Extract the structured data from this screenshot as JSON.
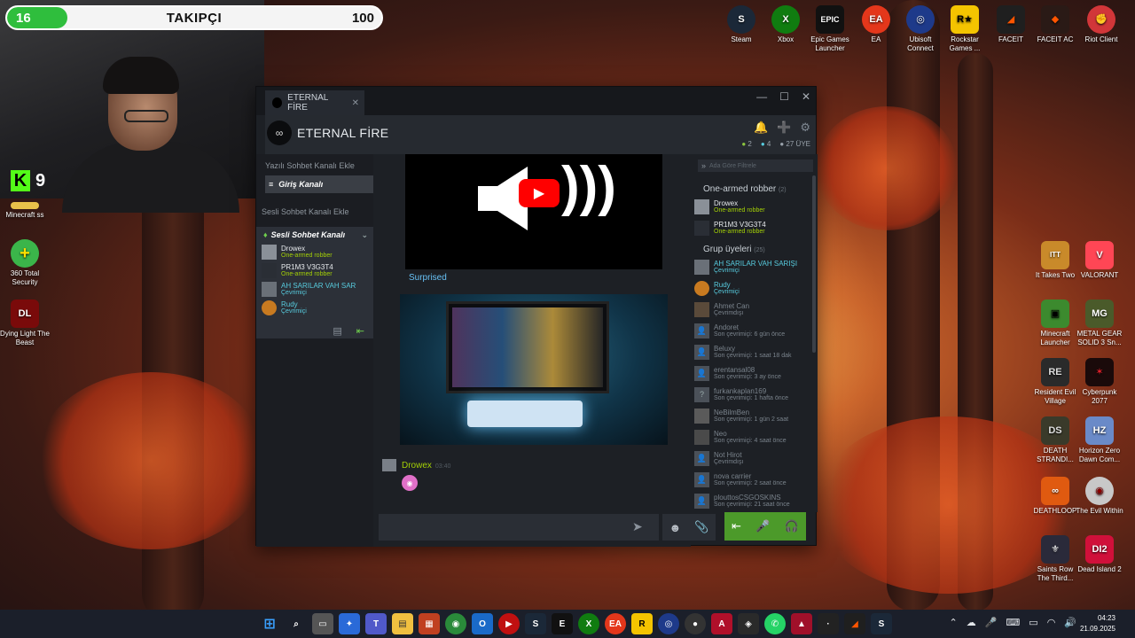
{
  "stream_overlay": {
    "follower_current": "16",
    "follower_label": "TAKIPÇI",
    "follower_goal": "100",
    "follower_progress": 0.16,
    "kick_count": "9"
  },
  "desktop_icons_top": [
    {
      "label": "Steam",
      "icon": "steam-icon",
      "color": "#1b2838"
    },
    {
      "label": "Xbox",
      "icon": "xbox-icon",
      "color": "#107c10"
    },
    {
      "label": "Epic Games Launcher",
      "icon": "epic-icon",
      "color": "#111111"
    },
    {
      "label": "EA",
      "icon": "ea-icon",
      "color": "#e4371b"
    },
    {
      "label": "Ubisoft Connect",
      "icon": "ubisoft-icon",
      "color": "#1e3a8a"
    },
    {
      "label": "Rockstar Games ...",
      "icon": "rockstar-icon",
      "color": "#f4c400"
    },
    {
      "label": "FACEIT",
      "icon": "faceit-icon",
      "color": "#1f1f1f"
    },
    {
      "label": "FACEIT AC",
      "icon": "faceit-ac-icon",
      "color": "#2a1a16"
    },
    {
      "label": "Riot Client",
      "icon": "riot-icon",
      "color": "#d13639"
    }
  ],
  "desktop_icons_left": [
    {
      "label": "Minecraft ss"
    },
    {
      "label": "360 Total Security"
    },
    {
      "label": "Dying Light The Beast"
    }
  ],
  "desktop_icons_right": [
    {
      "label": "It Takes Two"
    },
    {
      "label": "VALORANT"
    },
    {
      "label": "Minecraft Launcher"
    },
    {
      "label": "METAL GEAR SOLID 3 Sn..."
    },
    {
      "label": "Resident Evil Village"
    },
    {
      "label": "Cyberpunk 2077"
    },
    {
      "label": "DEATH STRANDI..."
    },
    {
      "label": "Horizon Zero Dawn Com..."
    },
    {
      "label": "DEATHLOOP"
    },
    {
      "label": "The Evil Within"
    },
    {
      "label": "Saints Row The Third..."
    },
    {
      "label": "Dead Island 2"
    }
  ],
  "steam_chat": {
    "tab_title": "ETERNAL FİRE",
    "group_name": "ETERNAL FİRE",
    "stats": {
      "in_game": "2",
      "online": "4",
      "members": "27 ÜYE"
    },
    "add_text_channel": "Yazılı Sohbet Kanalı Ekle",
    "text_channel": "Giriş Kanalı",
    "add_voice_channel": "Sesli Sohbet Kanalı Ekle",
    "voice_channel": "Sesli Sohbet Kanalı",
    "voice_users": [
      {
        "name": "Drowex",
        "status": "One-armed robber",
        "tone": "green"
      },
      {
        "name": "PR1M3 V3G3T4",
        "status": "One-armed robber",
        "tone": "green"
      },
      {
        "name": "AH SARILAR VAH SAR",
        "status": "Çevrimiçi",
        "tone": "blue"
      },
      {
        "name": "Rudy",
        "status": "Çevrimiçi",
        "tone": "blue"
      }
    ],
    "video_caption": "Surprised",
    "message": {
      "author": "Drowex",
      "time": "03:40"
    },
    "member_filter_placeholder": "Ada Göre Filtrele",
    "sections": {
      "playing_title": "One-armed robber",
      "playing_count": "(2)",
      "members_title": "Grup üyeleri",
      "members_count": "(25)"
    },
    "playing_members": [
      {
        "name": "Drowex",
        "status": "One-armed robber"
      },
      {
        "name": "PR1M3 V3G3T4",
        "status": "One-armed robber"
      }
    ],
    "group_members": [
      {
        "name": "AH SARILAR VAH SARIŞI",
        "status": "Çevrimiçi",
        "tone": "blue"
      },
      {
        "name": "Rudy",
        "status": "Çevrimiçi",
        "tone": "blue"
      },
      {
        "name": "Ahmet Can",
        "status": "Çevrimdışı",
        "tone": "gray"
      },
      {
        "name": "Andoret",
        "status": "Son çevrimiçi: 6 gün önce",
        "tone": "gray"
      },
      {
        "name": "Beluxy",
        "status": "Son çevrimiçi: 1 saat 18 dak",
        "tone": "gray"
      },
      {
        "name": "erentansal08",
        "status": "Son çevrimiçi: 3 ay önce",
        "tone": "gray"
      },
      {
        "name": "furkankaplan169",
        "status": "Son çevrimiçi: 1 hafta önce",
        "tone": "gray"
      },
      {
        "name": "NeBilmBen",
        "status": "Son çevrimiçi: 1 gün 2 saat",
        "tone": "gray"
      },
      {
        "name": "Neo",
        "status": "Son çevrimiçi: 4 saat önce",
        "tone": "gray"
      },
      {
        "name": "Not Hirot",
        "status": "Çevrimdışı",
        "tone": "gray"
      },
      {
        "name": "nova carrier",
        "status": "Son çevrimiçi: 2 saat önce",
        "tone": "gray"
      },
      {
        "name": "plouttosCSGOSKINS",
        "status": "Son çevrimiçi: 21 saat önce",
        "tone": "gray"
      }
    ]
  },
  "taskbar": {
    "time": "04:23",
    "date": "21.09.2025"
  }
}
